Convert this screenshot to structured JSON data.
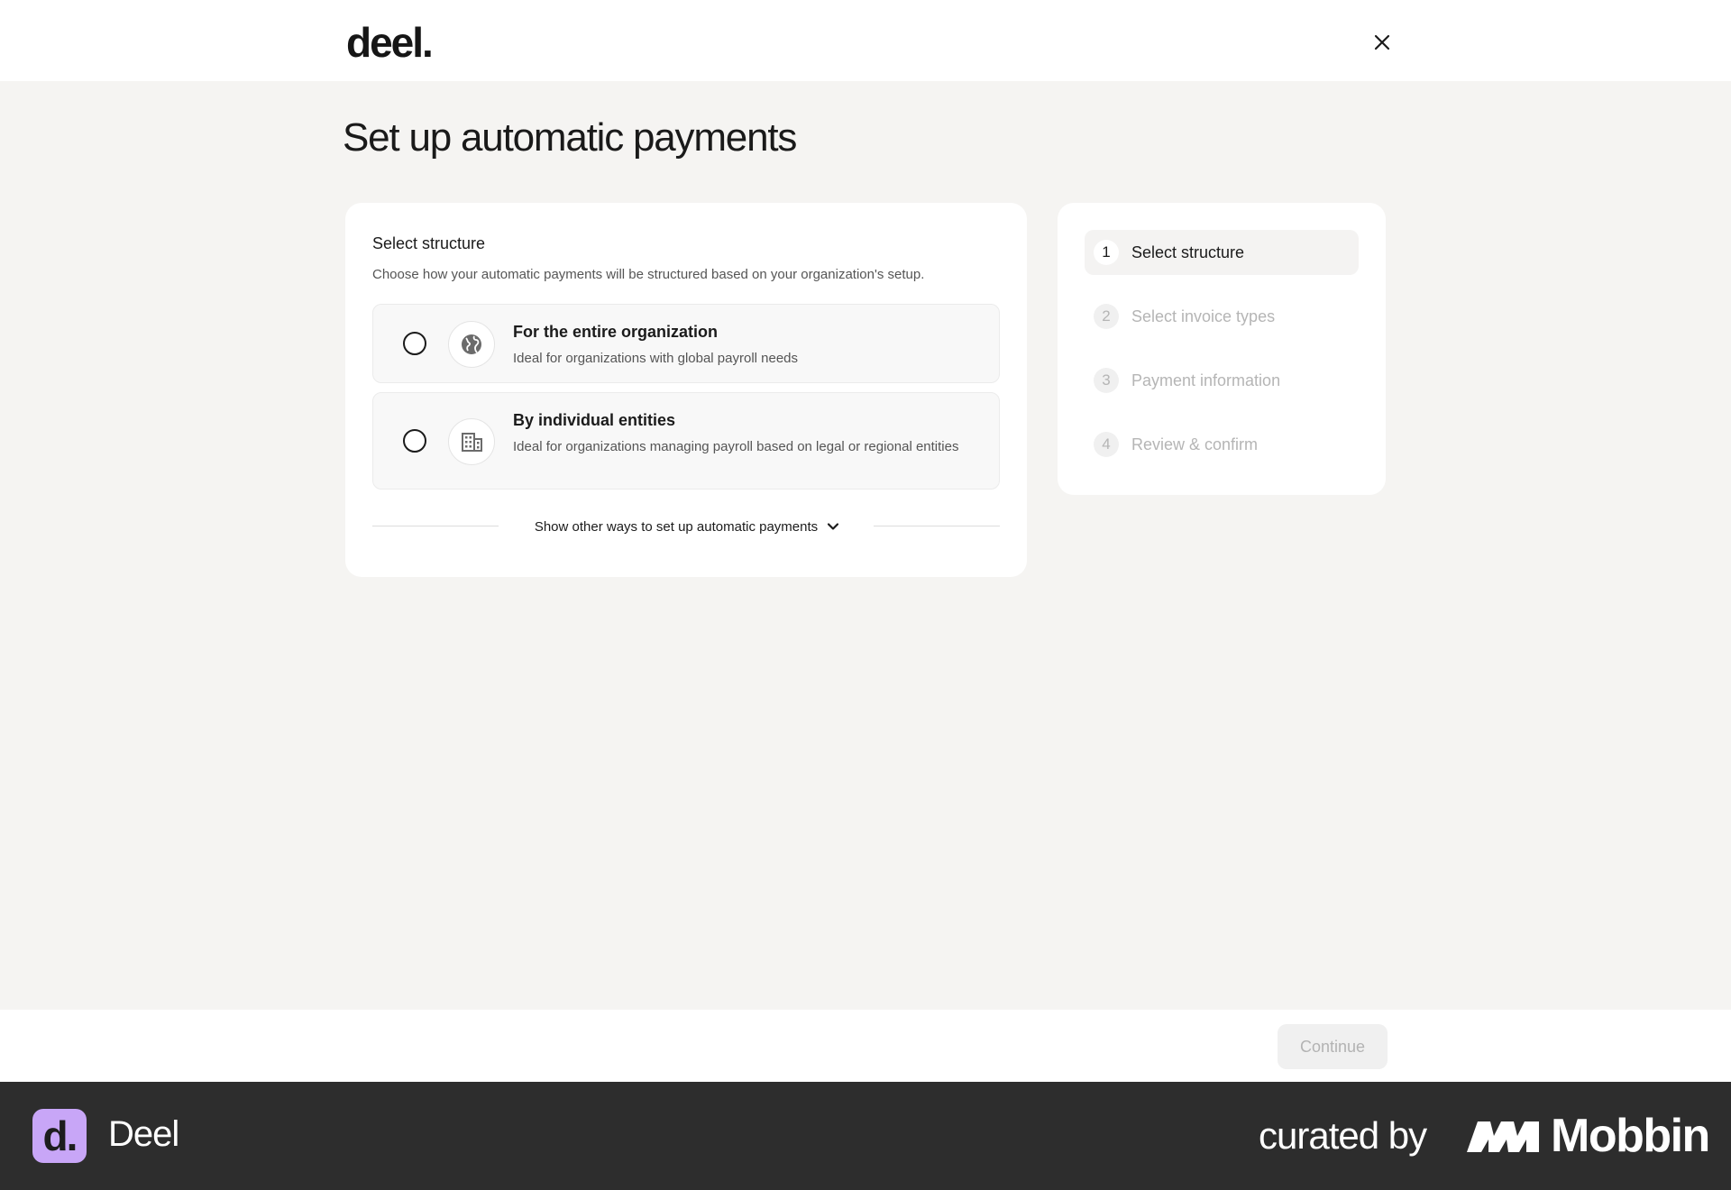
{
  "header": {
    "logo_text": "deel."
  },
  "page": {
    "title": "Set up automatic payments"
  },
  "structure": {
    "title": "Select structure",
    "description": "Choose how your automatic payments will be structured based on your organization's setup.",
    "options": [
      {
        "title": "For the entire organization",
        "description": "Ideal for organizations with global payroll needs",
        "icon": "globe-icon",
        "selected": false
      },
      {
        "title": "By individual entities",
        "description": "Ideal for organizations managing payroll based on legal or regional entities",
        "icon": "building-icon",
        "selected": false
      }
    ],
    "more_label": "Show other ways to set up automatic payments"
  },
  "steps": [
    {
      "number": "1",
      "label": "Select structure",
      "active": true
    },
    {
      "number": "2",
      "label": "Select invoice types",
      "active": false
    },
    {
      "number": "3",
      "label": "Payment information",
      "active": false
    },
    {
      "number": "4",
      "label": "Review & confirm",
      "active": false
    }
  ],
  "footer": {
    "continue_label": "Continue"
  },
  "attribution": {
    "badge_text": "d.",
    "app_name": "Deel",
    "curated_by": "curated by",
    "brand": "Mobbin"
  },
  "colors": {
    "badge": "#c8a6f7",
    "attrib_bg": "#2d2d2d",
    "page_bg": "#f5f4f2"
  }
}
